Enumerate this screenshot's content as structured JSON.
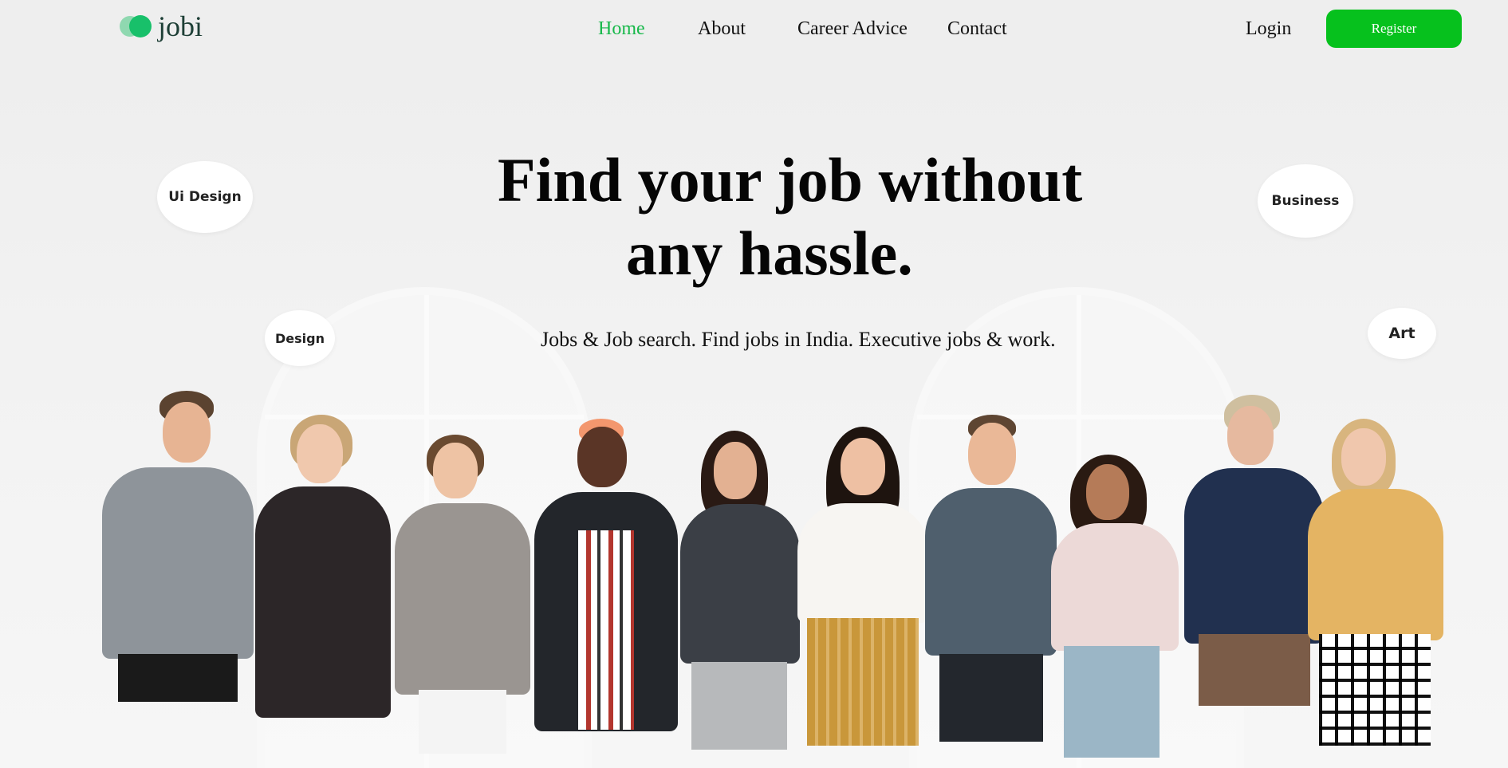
{
  "brand": {
    "name": "jobi",
    "colors": {
      "primary": "#06c11d",
      "logo_light": "#8fd8b0",
      "logo_dark": "#18c06a"
    }
  },
  "nav": {
    "items": [
      {
        "label": "Home",
        "active": true
      },
      {
        "label": "About",
        "active": false
      },
      {
        "label": "Career Advice",
        "active": false
      },
      {
        "label": "Contact",
        "active": false
      }
    ]
  },
  "auth": {
    "login_label": "Login",
    "register_label": "Register"
  },
  "hero": {
    "title_line1": "Find your job without",
    "title_line2": "any hassle.",
    "subtitle": "Jobs & Job search. Find jobs in India. Executive jobs & work.",
    "tags": [
      "Ui Design",
      "Business",
      "Design",
      "Art"
    ],
    "image_icon": "team-photo"
  }
}
